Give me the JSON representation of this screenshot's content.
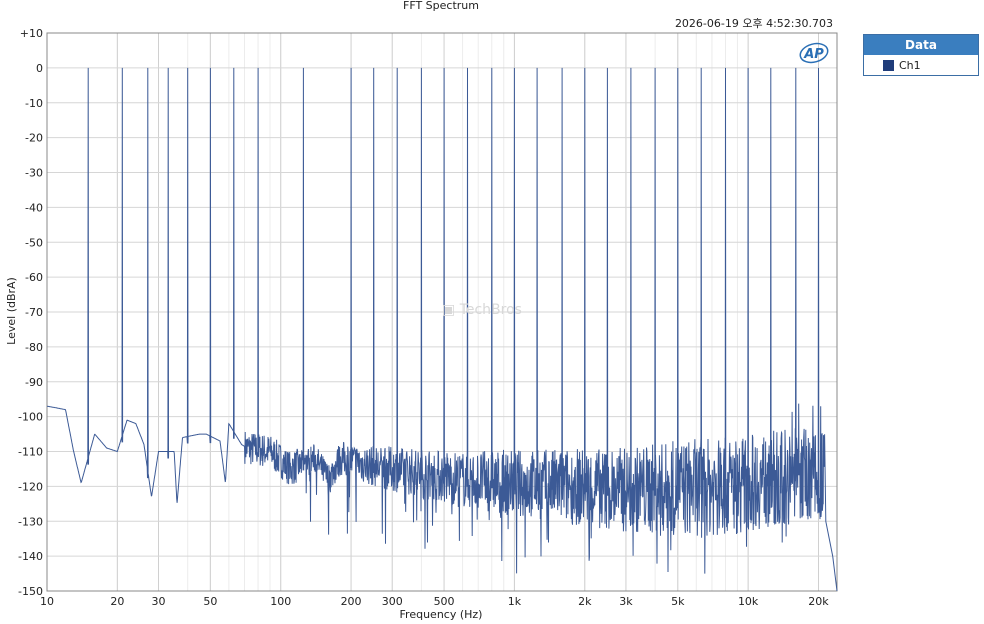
{
  "chart_data": {
    "type": "line",
    "title": "FFT Spectrum",
    "timestamp": "2026-06-19 오후 4:52:30.703",
    "xlabel": "Frequency (Hz)",
    "ylabel": "Level (dBrA)",
    "xscale": "log",
    "xlim": [
      10,
      24000
    ],
    "ylim": [
      -150,
      10
    ],
    "grid": true,
    "x_ticks": [
      {
        "v": 10,
        "label": "10"
      },
      {
        "v": 20,
        "label": "20"
      },
      {
        "v": 30,
        "label": "30"
      },
      {
        "v": 50,
        "label": "50"
      },
      {
        "v": 100,
        "label": "100"
      },
      {
        "v": 200,
        "label": "200"
      },
      {
        "v": 300,
        "label": "300"
      },
      {
        "v": 500,
        "label": "500"
      },
      {
        "v": 1000,
        "label": "1k"
      },
      {
        "v": 2000,
        "label": "2k"
      },
      {
        "v": 3000,
        "label": "3k"
      },
      {
        "v": 5000,
        "label": "5k"
      },
      {
        "v": 10000,
        "label": "10k"
      },
      {
        "v": 20000,
        "label": "20k"
      }
    ],
    "y_ticks": [
      {
        "v": 10,
        "label": "+10"
      },
      {
        "v": 0,
        "label": "0"
      },
      {
        "v": -10,
        "label": "-10"
      },
      {
        "v": -20,
        "label": "-20"
      },
      {
        "v": -30,
        "label": "-30"
      },
      {
        "v": -40,
        "label": "-40"
      },
      {
        "v": -50,
        "label": "-50"
      },
      {
        "v": -60,
        "label": "-60"
      },
      {
        "v": -70,
        "label": "-70"
      },
      {
        "v": -80,
        "label": "-80"
      },
      {
        "v": -90,
        "label": "-90"
      },
      {
        "v": -100,
        "label": "-100"
      },
      {
        "v": -110,
        "label": "-110"
      },
      {
        "v": -120,
        "label": "-120"
      },
      {
        "v": -130,
        "label": "-130"
      },
      {
        "v": -140,
        "label": "-140"
      },
      {
        "v": -150,
        "label": "-150"
      }
    ],
    "series": [
      {
        "name": "Ch1",
        "color": "#3c5a96",
        "peaks_hz": [
          15,
          21,
          27,
          33,
          40,
          50,
          63,
          80,
          125,
          200,
          250,
          315,
          400,
          500,
          630,
          800,
          1000,
          1250,
          1600,
          2000,
          2500,
          3150,
          4000,
          5000,
          6300,
          8000,
          10000,
          12500,
          16000,
          20000
        ],
        "peak_level_db": 0,
        "floor_points": [
          [
            10,
            -97
          ],
          [
            11,
            -97.5
          ],
          [
            12,
            -98
          ],
          [
            13,
            -110
          ],
          [
            14,
            -119
          ],
          [
            16,
            -105
          ],
          [
            18,
            -109
          ],
          [
            20,
            -110
          ],
          [
            22,
            -101
          ],
          [
            24,
            -102
          ],
          [
            26,
            -108
          ],
          [
            28,
            -123
          ],
          [
            30,
            -110
          ],
          [
            35,
            -110
          ],
          [
            36,
            -125
          ],
          [
            38,
            -106
          ],
          [
            45,
            -105
          ],
          [
            48,
            -105
          ],
          [
            55,
            -107
          ],
          [
            58,
            -119
          ],
          [
            60,
            -102
          ],
          [
            68,
            -108
          ],
          [
            72,
            -109
          ],
          [
            90,
            -110
          ],
          [
            110,
            -115
          ],
          [
            140,
            -112
          ],
          [
            160,
            -118
          ],
          [
            180,
            -112
          ],
          [
            240,
            -114
          ],
          [
            600,
            -118
          ],
          [
            1000,
            -119
          ],
          [
            3000,
            -121
          ],
          [
            8000,
            -120
          ],
          [
            15000,
            -117
          ],
          [
            20000,
            -115
          ],
          [
            24000,
            -120
          ]
        ],
        "noise_band_db": [
          -135,
          -108
        ],
        "hf_rolloff": [
          [
            21500,
            -130
          ],
          [
            23000,
            -140
          ],
          [
            24000,
            -150
          ]
        ]
      }
    ],
    "legend": {
      "title": "Data",
      "position": "top-right-outside"
    }
  },
  "logo": {
    "text": "AP",
    "color": "#2a6fb5"
  },
  "watermark": {
    "text": "TechBros"
  }
}
